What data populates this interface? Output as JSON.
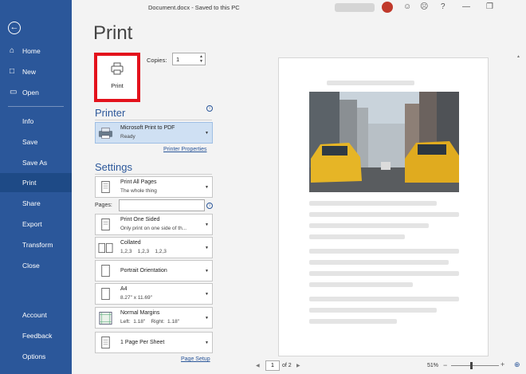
{
  "titlebar": {
    "doc_name": "Document.docx",
    "separator": "-",
    "status": "Saved to this PC",
    "smile_icon": "☺",
    "frown_icon": "☹",
    "help": "?",
    "minimize": "—",
    "restore": "❐"
  },
  "nav": {
    "back_icon": "←",
    "items": [
      {
        "label": "Home",
        "icon": "⌂"
      },
      {
        "label": "New",
        "icon": "□"
      },
      {
        "label": "Open",
        "icon": "▭"
      },
      {
        "label": "Info"
      },
      {
        "label": "Save"
      },
      {
        "label": "Save As"
      },
      {
        "label": "Print"
      },
      {
        "label": "Share"
      },
      {
        "label": "Export"
      },
      {
        "label": "Transform"
      },
      {
        "label": "Close"
      },
      {
        "label": "Account"
      },
      {
        "label": "Feedback"
      },
      {
        "label": "Options"
      }
    ],
    "active": "Print"
  },
  "print": {
    "title": "Print",
    "button_label": "Print",
    "copies_label": "Copies:",
    "copies_value": "1"
  },
  "printer": {
    "section_title": "Printer",
    "name": "Microsoft Print to PDF",
    "status": "Ready",
    "properties_link": "Printer Properties"
  },
  "settings": {
    "section_title": "Settings",
    "print_range": {
      "main": "Print All Pages",
      "sub": "The whole thing"
    },
    "pages_label": "Pages:",
    "pages_value": "",
    "sides": {
      "main": "Print One Sided",
      "sub": "Only print on one side of th..."
    },
    "collate": {
      "main": "Collated",
      "sub": "1,2,3    1,2,3    1,2,3"
    },
    "orientation": {
      "main": "Portrait Orientation"
    },
    "paper": {
      "main": "A4",
      "sub": "8.27\" x 11.69\""
    },
    "margins": {
      "main": "Normal Margins",
      "sub": "Left:  1.18\"    Right:  1.18\""
    },
    "per_sheet": {
      "main": "1 Page Per Sheet"
    },
    "page_setup_link": "Page Setup"
  },
  "preview": {
    "current_page": "1",
    "of_pages": "of 2",
    "zoom": "51%",
    "zoom_minus": "−",
    "zoom_plus": "+",
    "prev_icon": "◀",
    "next_icon": "▶"
  }
}
